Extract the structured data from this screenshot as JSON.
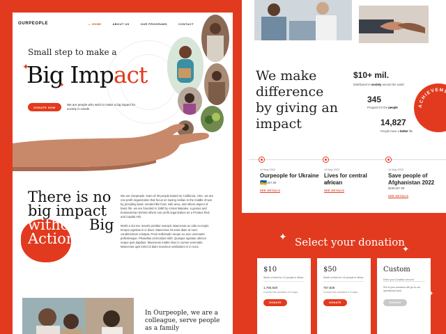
{
  "brand": "OURPEOPLE",
  "nav": [
    "HOME",
    "ABOUT US",
    "OUR PROGRAMS",
    "CONTACT"
  ],
  "hero": {
    "small": "Small step to make a",
    "big_a": "Big Imp",
    "big_b": "act",
    "button": "DONATE NOW",
    "desc": "We are people who wish to make a big impact for society in needs"
  },
  "section2": {
    "l1": "There is no",
    "l2": "big impact",
    "l3": "without",
    "l3b": " Big",
    "l4": "Action”",
    "p1": "We are Ourpeople. team of 30 people based on California, USA. we are non profit organization that focus on saving civilian in the middle of war by providing basic needed like food, safe area, and others aspect of basic life. we are founded in 1980 by Azmar Bakalee, a genius and businessman behind others non profit organization as a Product Red, and Capital AID.",
    "p2": "Morbi a dui nec mauris porttitor suscipit. Maecenas ac odio eu turpis tempor egestas in in diam. Maecenas sit amet diam ut nunc condimentum volutpat. Proin sollicitudin neque eu arcu venenatis pellentesque. Phasellus at tincidunt nibh. Quisque egestas ultrices neque quis dapibus. Maecenas mattis risus in cursus venenatis. Maecenas quis tortor id diam maximus vestibulum in in nunc."
  },
  "family": "In Ourpeople, we are a colleague, serve people as a family",
  "impact": {
    "l1": "We make",
    "l2": "difference",
    "l3": "by giving an",
    "l4": "impact",
    "stats": [
      {
        "num": "$10+ mil.",
        "pre": "Distributed to ",
        "bold": "society",
        "post": " around the world"
      },
      {
        "num": "345",
        "pre": "Program for the ",
        "bold": "people",
        "post": ""
      },
      {
        "num": "14,827",
        "pre": "People have a ",
        "bold": "better",
        "post": " life"
      }
    ],
    "badge": "ACHIEVEMENT"
  },
  "events": [
    {
      "date": "14 May 2022",
      "title": "Ourpeople for Ukraine 🇺🇦",
      "amount": "$190,827.89",
      "link": "SEE DETAILS"
    },
    {
      "date": "14 May 2022",
      "title": "Lives for central african",
      "amount": "$350,842.91",
      "link": "SEE DETAILS"
    },
    {
      "date": "14 May 2022",
      "title": "Save people of Afghanistan 2022",
      "amount": "$190,827.89",
      "link": "SEE DETAILS"
    }
  ],
  "donation": {
    "title": "Select your donation",
    "cards": [
      {
        "amount": "$10",
        "sub": "Worth of feed for 10 people in Africa",
        "count": "1,765,928",
        "count_sub": "Choose this donation in 5 days",
        "button": "DONATE"
      },
      {
        "amount": "$50",
        "sub": "Worth of feed for 15 people in Africa",
        "count": "767,828",
        "count_sub": "Choose this donation in 5 days",
        "button": "DONATE"
      },
      {
        "amount": "Custom",
        "placeholder": "Enter your Donation amount",
        "note": "5% of your donation will go to our operational fund",
        "button": "DONATE"
      }
    ]
  },
  "colors": {
    "accent": "#e23a1e",
    "text": "#111111",
    "panel": "#ffffff"
  }
}
